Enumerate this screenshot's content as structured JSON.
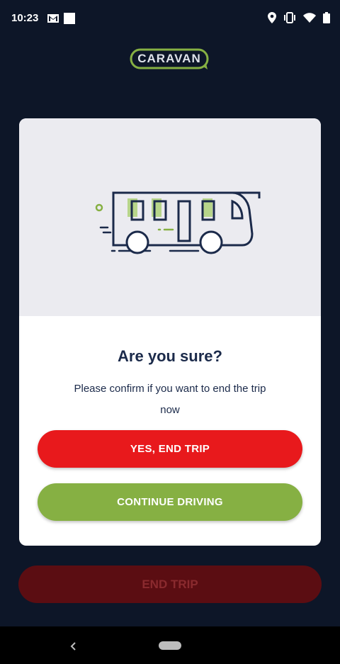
{
  "status_bar": {
    "time": "10:23",
    "icons": [
      "gmail-icon",
      "square-notification-icon",
      "location-icon",
      "vibrate-icon",
      "wifi-icon",
      "battery-icon"
    ]
  },
  "logo": {
    "text": "CARAVAN",
    "color": "#86b043"
  },
  "dialog": {
    "title": "Are you sure?",
    "message": "Please confirm if you want to end the trip now",
    "confirm_label": "YES, END TRIP",
    "cancel_label": "CONTINUE DRIVING",
    "illustration": "bus-illustration"
  },
  "background": {
    "end_trip_label": "END TRIP"
  },
  "colors": {
    "danger": "#e8191c",
    "success": "#86b043",
    "navy": "#1b2a4a",
    "background": "#0d1628"
  }
}
